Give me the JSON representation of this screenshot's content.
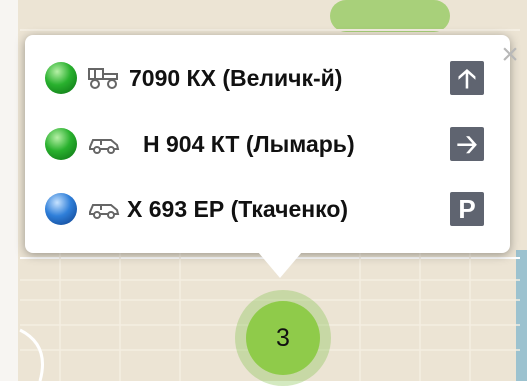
{
  "popup": {
    "close_label": "×",
    "vehicles": [
      {
        "status_color": "#29b12e",
        "icon": "tractor-icon",
        "label": "7090 КХ (Величк-й)",
        "action_icon": "arrow-up-icon",
        "action_glyph": "🡡"
      },
      {
        "status_color": "#29b12e",
        "icon": "car-icon",
        "label": "Н 904 КТ (Лымарь)",
        "action_icon": "arrow-right-icon",
        "action_glyph": "🡢"
      },
      {
        "status_color": "#2f7fd9",
        "icon": "car-icon",
        "label": "Х 693 ЕР (Ткаченко)",
        "action_icon": "parking-icon",
        "action_glyph": "P"
      }
    ]
  },
  "cluster": {
    "count": "3",
    "color": "#8fcb4a"
  }
}
